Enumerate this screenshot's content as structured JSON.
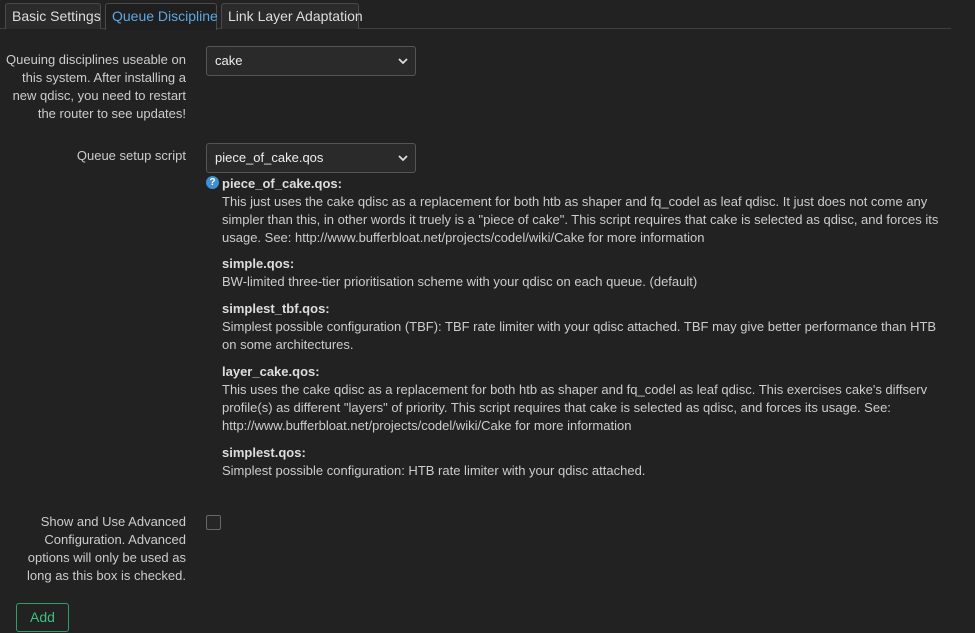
{
  "tabs": [
    {
      "label": "Basic Settings"
    },
    {
      "label": "Queue Discipline"
    },
    {
      "label": "Link Layer Adaptation"
    }
  ],
  "qdisc": {
    "label": "Queuing disciplines useable on this system. After installing a new qdisc, you need to restart the router to see updates!",
    "selected": "cake"
  },
  "script": {
    "label": "Queue setup script",
    "selected": "piece_of_cake.qos"
  },
  "help_entries": [
    {
      "name": "piece_of_cake.qos:",
      "description": "This just uses the cake qdisc as a replacement for both htb as shaper and fq_codel as leaf qdisc. It just does not come any simpler than this, in other words it truely is a \"piece of cake\". This script requires that cake is selected as qdisc, and forces its usage. See: http://www.bufferbloat.net/projects/codel/wiki/Cake for more information"
    },
    {
      "name": "simple.qos:",
      "description": "BW-limited three-tier prioritisation scheme with your qdisc on each queue. (default)"
    },
    {
      "name": "simplest_tbf.qos:",
      "description": "Simplest possible configuration (TBF): TBF rate limiter with your qdisc attached. TBF may give better performance than HTB on some architectures."
    },
    {
      "name": "layer_cake.qos:",
      "description": "This uses the cake qdisc as a replacement for both htb as shaper and fq_codel as leaf qdisc. This exercises cake's diffserv profile(s) as different \"layers\" of priority. This script requires that cake is selected as qdisc, and forces its usage. See: http://www.bufferbloat.net/projects/codel/wiki/Cake for more information"
    },
    {
      "name": "simplest.qos:",
      "description": "Simplest possible configuration: HTB rate limiter with your qdisc attached."
    }
  ],
  "advanced": {
    "label": "Show and Use Advanced Configuration. Advanced options will only be used as long as this box is checked.",
    "checked": false
  },
  "add_button": {
    "label": "Add"
  },
  "colors": {
    "active_tab": "#5aa8e0",
    "help_icon": "#3d8fd6",
    "add_button": "#3fbf80"
  }
}
